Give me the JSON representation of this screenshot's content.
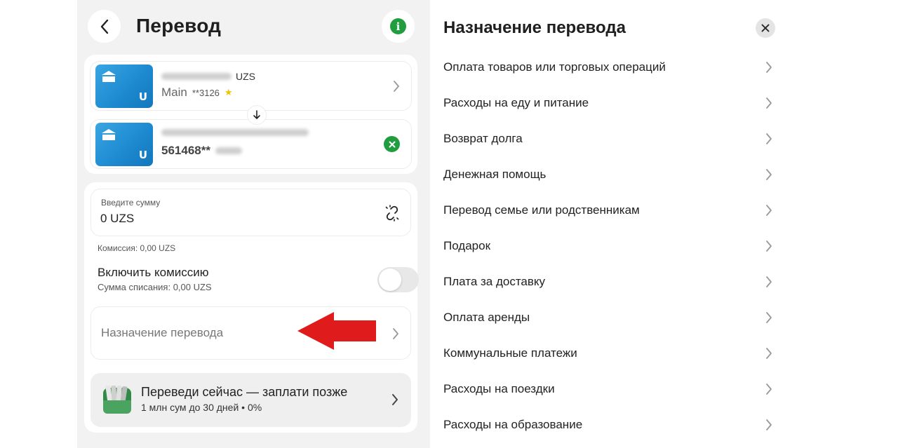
{
  "header": {
    "title": "Перевод"
  },
  "cards": {
    "from": {
      "currency": "UZS",
      "name": "Main",
      "mask": "**3126",
      "star": "★"
    },
    "to": {
      "number_prefix": "561468**"
    }
  },
  "form": {
    "amount_label": "Введите сумму",
    "amount_value": "0 UZS",
    "commission": "Комиссия: 0,00 UZS",
    "toggle_title": "Включить комиссию",
    "toggle_sub": "Сумма списания: 0,00 UZS",
    "toggle_on": false,
    "purpose_placeholder": "Назначение перевода"
  },
  "promo": {
    "title": "Переведи сейчас — заплати позже",
    "subtitle": "1 млн сум до 30 дней • 0%"
  },
  "sheet": {
    "title": "Назначение перевода",
    "items": [
      "Оплата товаров или торговых операций",
      "Расходы на еду и питание",
      "Возврат долга",
      "Денежная помощь",
      "Перевод семье или родственникам",
      "Подарок",
      "Плата за доставку",
      "Оплата аренды",
      "Коммунальные платежи",
      "Расходы на поездки",
      "Расходы на образование"
    ]
  },
  "colors": {
    "accent_green": "#1f9d3f",
    "card_blue": "#1e8ad1",
    "annotation_red": "#e01b1b"
  },
  "icons": [
    "back-arrow-icon",
    "info-icon",
    "bank-logo-icon",
    "swap-arrow-icon",
    "clear-icon",
    "link-icon",
    "chevron-right-icon",
    "wallet-icon",
    "close-icon",
    "annotation-arrow"
  ]
}
